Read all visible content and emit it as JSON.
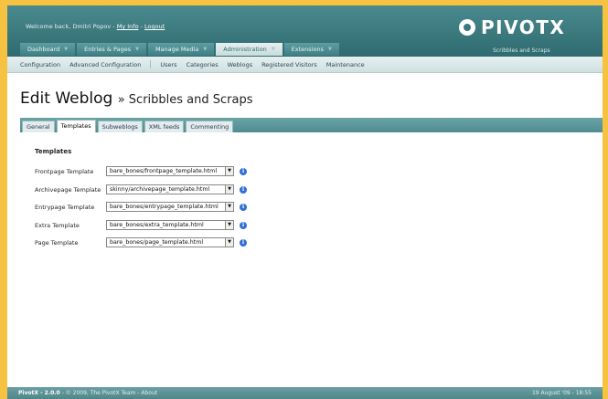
{
  "header": {
    "welcome_prefix": "Welcome back, Dmitri Popov - ",
    "my_info": "My Info",
    "dash": " - ",
    "logout": "Logout",
    "logo": "PIVOTX",
    "tagline": "Scribbles and Scraps"
  },
  "mainnav": [
    {
      "label": "Dashboard"
    },
    {
      "label": "Entries & Pages"
    },
    {
      "label": "Manage Media"
    },
    {
      "label": "Administration"
    },
    {
      "label": "Extensions"
    }
  ],
  "subnav": [
    {
      "label": "Configuration"
    },
    {
      "label": "Advanced Configuration"
    },
    {
      "label": "Users"
    },
    {
      "label": "Categories"
    },
    {
      "label": "Weblogs"
    },
    {
      "label": "Registered Visitors"
    },
    {
      "label": "Maintenance"
    }
  ],
  "page": {
    "title": "Edit Weblog",
    "subtitle": "» Scribbles and Scraps"
  },
  "tabs": [
    {
      "label": "General"
    },
    {
      "label": "Templates"
    },
    {
      "label": "Subweblogs"
    },
    {
      "label": "XML feeds"
    },
    {
      "label": "Commenting"
    }
  ],
  "form": {
    "section_title": "Templates",
    "rows": [
      {
        "label": "Frontpage Template",
        "value": "bare_bones/frontpage_template.html"
      },
      {
        "label": "Archivepage Template",
        "value": "skinny/archivepage_template.html"
      },
      {
        "label": "Entrypage Template",
        "value": "bare_bones/entrypage_template.html"
      },
      {
        "label": "Extra Template",
        "value": "bare_bones/extra_template.html"
      },
      {
        "label": "Page Template",
        "value": "bare_bones/page_template.html"
      }
    ]
  },
  "footer": {
    "version": "PivotX - 2.0.0",
    "copyright": " - © 2009, The PivotX Team - About",
    "date": "19 August '09 - 18:55"
  },
  "colors": {
    "accent": "#3a777c",
    "border": "#f5c242",
    "info": "#2f6fd6"
  }
}
